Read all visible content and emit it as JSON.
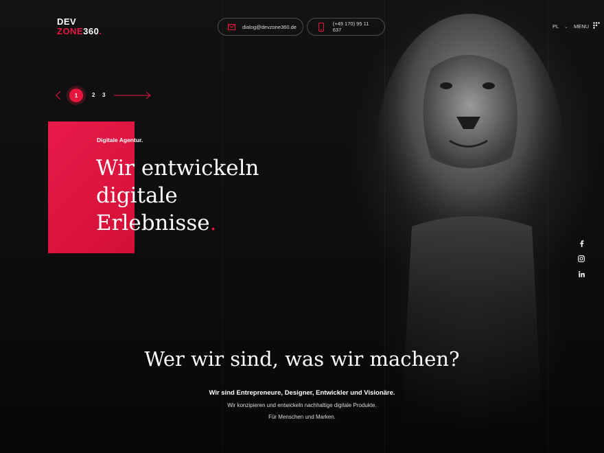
{
  "header": {
    "logo_line1": "DEV",
    "logo_line2_text": "ZONE",
    "logo_line2_num": "360",
    "logo_dot": ".",
    "email": "dialog@devzone360.de",
    "phone": "(+49 170) 95 11 637",
    "language": "PL",
    "menu_label": "MENU"
  },
  "slider": {
    "slides": [
      "1",
      "2",
      "3"
    ],
    "active": "1"
  },
  "hero": {
    "subtitle": "Digitale Agentur.",
    "headline_lines": [
      "Wir entwickeln",
      "digitale",
      "Erlebnisse"
    ],
    "headline_dot": "."
  },
  "social": {
    "icons": [
      "facebook-icon",
      "instagram-icon",
      "linkedin-icon"
    ]
  },
  "about": {
    "title": "Wer wir sind, was wir machen?",
    "lead": "Wir sind Entrepreneure, Designer, Entwickler und Visionäre.",
    "line1": "Wir konzipieren und entwickeln nachhaltige digitale Produkte.",
    "line2": "Für Menschen und Marken."
  },
  "colors": {
    "accent": "#e5173f",
    "background": "#0b0b0c"
  }
}
